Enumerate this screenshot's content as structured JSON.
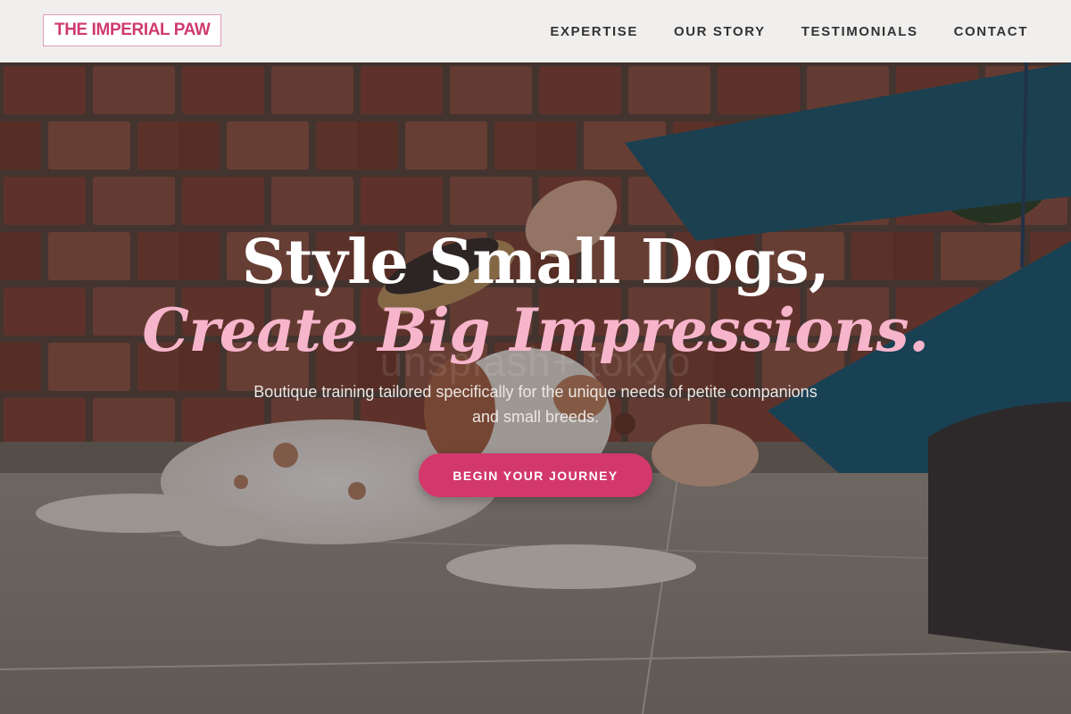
{
  "header": {
    "logo_text": "THE IMPERIAL PAW",
    "nav": [
      {
        "label": "EXPERTISE"
      },
      {
        "label": "OUR STORY"
      },
      {
        "label": "TESTIMONIALS"
      },
      {
        "label": "CONTACT"
      }
    ]
  },
  "hero": {
    "title_line_1": "Style Small Dogs,",
    "title_line_2": "Create Big Impressions.",
    "subtitle": "Boutique training tailored specifically for the unique needs of petite companions and small breeds.",
    "cta_label": "BEGIN YOUR JOURNEY",
    "watermark": "unsplash+ tokyo"
  },
  "colors": {
    "brand_pink": "#cf3b70",
    "cta_pink": "#d2386c",
    "accent_title_pink": "#f7b5cc",
    "header_bg": "#f0efee",
    "nav_text": "#333333"
  }
}
